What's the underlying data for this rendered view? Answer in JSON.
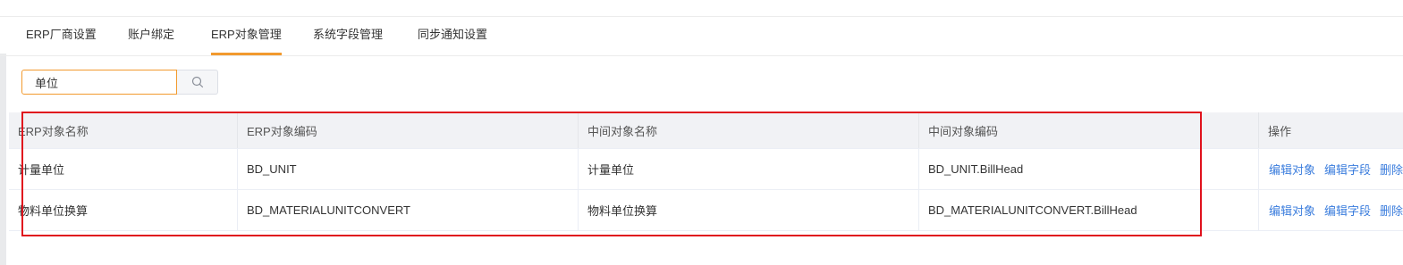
{
  "tabs": [
    {
      "label": "ERP厂商设置"
    },
    {
      "label": "账户绑定"
    },
    {
      "label": "ERP对象管理"
    },
    {
      "label": "系统字段管理"
    },
    {
      "label": "同步通知设置"
    }
  ],
  "active_tab": "ERP对象管理",
  "search": {
    "value": "单位",
    "icon": "search-icon"
  },
  "table": {
    "columns": [
      "ERP对象名称",
      "ERP对象编码",
      "中间对象名称",
      "中间对象编码",
      "操作"
    ],
    "rows": [
      {
        "erp_name": "计量单位",
        "erp_code": "BD_UNIT",
        "mid_name": "计量单位",
        "mid_code": "BD_UNIT.BillHead",
        "actions": [
          "编辑对象",
          "编辑字段",
          "删除"
        ]
      },
      {
        "erp_name": "物料单位换算",
        "erp_code": "BD_MATERIALUNITCONVERT",
        "mid_name": "物料单位换算",
        "mid_code": "BD_MATERIALUNITCONVERT.BillHead",
        "actions": [
          "编辑对象",
          "编辑字段",
          "删除"
        ]
      }
    ]
  },
  "colors": {
    "accent": "#f29a2e",
    "link": "#3b7ddd",
    "highlight": "#e0121d",
    "header_bg": "#f1f2f5"
  }
}
